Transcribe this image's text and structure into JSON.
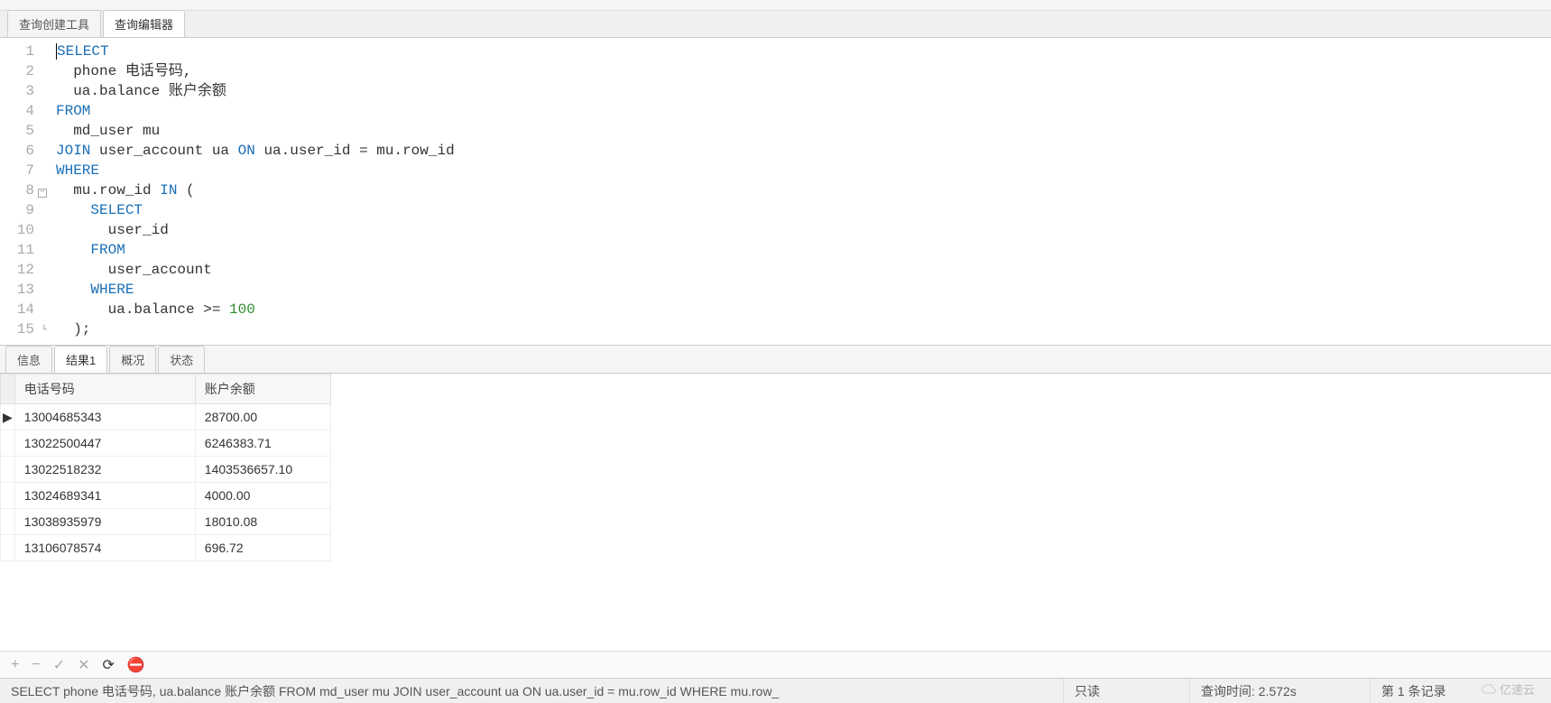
{
  "top_tabs": {
    "builder": "查询创建工具",
    "editor": "查询编辑器"
  },
  "sql": {
    "lines": [
      {
        "n": 1,
        "tokens": [
          {
            "t": "SELECT",
            "c": "kw",
            "caret": true
          }
        ]
      },
      {
        "n": 2,
        "tokens": [
          {
            "t": "  phone 电话号码,"
          }
        ]
      },
      {
        "n": 3,
        "tokens": [
          {
            "t": "  ua.balance 账户余额"
          }
        ]
      },
      {
        "n": 4,
        "tokens": [
          {
            "t": "FROM",
            "c": "kw"
          }
        ]
      },
      {
        "n": 5,
        "tokens": [
          {
            "t": "  md_user mu"
          }
        ]
      },
      {
        "n": 6,
        "tokens": [
          {
            "t": "JOIN",
            "c": "kw"
          },
          {
            "t": " user_account ua "
          },
          {
            "t": "ON",
            "c": "kw"
          },
          {
            "t": " ua.user_id = mu.row_id"
          }
        ]
      },
      {
        "n": 7,
        "tokens": [
          {
            "t": "WHERE",
            "c": "kw"
          }
        ]
      },
      {
        "n": 8,
        "tokens": [
          {
            "t": "  mu.row_id "
          },
          {
            "t": "IN",
            "c": "kw"
          },
          {
            "t": " ("
          }
        ],
        "fold": "open"
      },
      {
        "n": 9,
        "tokens": [
          {
            "t": "    "
          },
          {
            "t": "SELECT",
            "c": "kw"
          }
        ]
      },
      {
        "n": 10,
        "tokens": [
          {
            "t": "      user_id"
          }
        ]
      },
      {
        "n": 11,
        "tokens": [
          {
            "t": "    "
          },
          {
            "t": "FROM",
            "c": "kw"
          }
        ]
      },
      {
        "n": 12,
        "tokens": [
          {
            "t": "      user_account"
          }
        ]
      },
      {
        "n": 13,
        "tokens": [
          {
            "t": "    "
          },
          {
            "t": "WHERE",
            "c": "kw"
          }
        ]
      },
      {
        "n": 14,
        "tokens": [
          {
            "t": "      ua.balance >= "
          },
          {
            "t": "100",
            "c": "num"
          }
        ]
      },
      {
        "n": 15,
        "tokens": [
          {
            "t": "  );"
          }
        ],
        "fold": "close"
      }
    ]
  },
  "result_tabs": {
    "info": "信息",
    "result1": "结果1",
    "profile": "概况",
    "status": "状态"
  },
  "columns": [
    "电话号码",
    "账户余额"
  ],
  "rows": [
    {
      "active": true,
      "cells": [
        "13004685343",
        "28700.00"
      ]
    },
    {
      "active": false,
      "cells": [
        "13022500447",
        "6246383.71"
      ]
    },
    {
      "active": false,
      "cells": [
        "13022518232",
        "1403536657.10"
      ]
    },
    {
      "active": false,
      "cells": [
        "13024689341",
        "4000.00"
      ]
    },
    {
      "active": false,
      "cells": [
        "13038935979",
        "18010.08"
      ]
    },
    {
      "active": false,
      "cells": [
        "13106078574",
        "696.72"
      ]
    }
  ],
  "nav": {
    "add": "+",
    "remove": "−",
    "apply": "✓",
    "cancel": "✕",
    "refresh": "⟳",
    "stop": "⛔"
  },
  "status": {
    "query": "SELECT phone 电话号码, ua.balance 账户余额  FROM md_user mu JOIN user_account ua ON ua.user_id = mu.row_id WHERE mu.row_",
    "readonly": "只读",
    "time": "查询时间: 2.572s",
    "record": "第 1 条记录"
  },
  "watermark": "亿速云"
}
